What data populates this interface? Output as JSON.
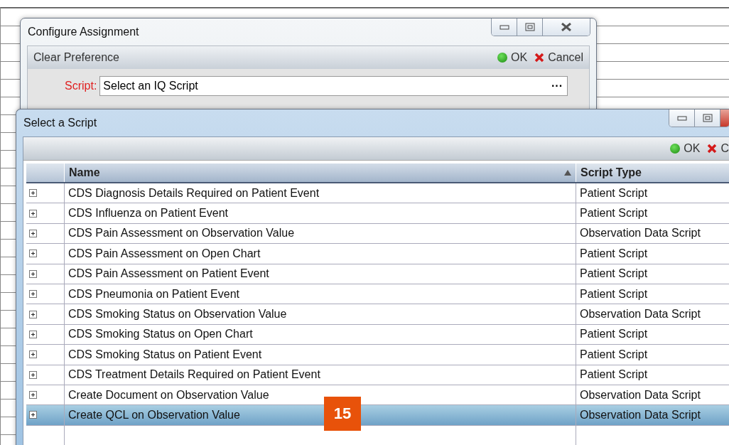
{
  "back_window": {
    "title": "Configure Assignment",
    "panel_title": "Clear Preference",
    "ok": "OK",
    "cancel": "Cancel",
    "field_label": "Script:",
    "field_value": "Select an IQ Script",
    "browse": "···"
  },
  "front_window": {
    "title": "Select a Script",
    "ok": "OK",
    "cancel": "C",
    "table": {
      "columns": [
        {
          "label": "Name",
          "sorted": true
        },
        {
          "label": "Script Type",
          "sorted": false
        }
      ],
      "rows": [
        {
          "name": "CDS Diagnosis Details Required on Patient Event",
          "type": "Patient Script",
          "selected": false
        },
        {
          "name": "CDS Influenza on Patient Event",
          "type": "Patient Script",
          "selected": false
        },
        {
          "name": "CDS Pain Assessment on Observation Value",
          "type": "Observation Data Script",
          "selected": false
        },
        {
          "name": "CDS Pain Assessment on Open Chart",
          "type": "Patient Script",
          "selected": false
        },
        {
          "name": "CDS Pain Assessment on Patient Event",
          "type": "Patient Script",
          "selected": false
        },
        {
          "name": "CDS Pneumonia on Patient Event",
          "type": "Patient Script",
          "selected": false
        },
        {
          "name": "CDS Smoking Status on Observation Value",
          "type": "Observation Data Script",
          "selected": false
        },
        {
          "name": "CDS Smoking Status on Open Chart",
          "type": "Patient Script",
          "selected": false
        },
        {
          "name": "CDS Smoking Status on Patient Event",
          "type": "Patient Script",
          "selected": false
        },
        {
          "name": "CDS Treatment Details Required on Patient Event",
          "type": "Patient Script",
          "selected": false
        },
        {
          "name": "Create Document on Observation Value",
          "type": "Observation Data Script",
          "selected": false
        },
        {
          "name": "Create QCL on Observation Value",
          "type": "Observation Data Script",
          "selected": true
        }
      ]
    }
  },
  "callout": "15"
}
